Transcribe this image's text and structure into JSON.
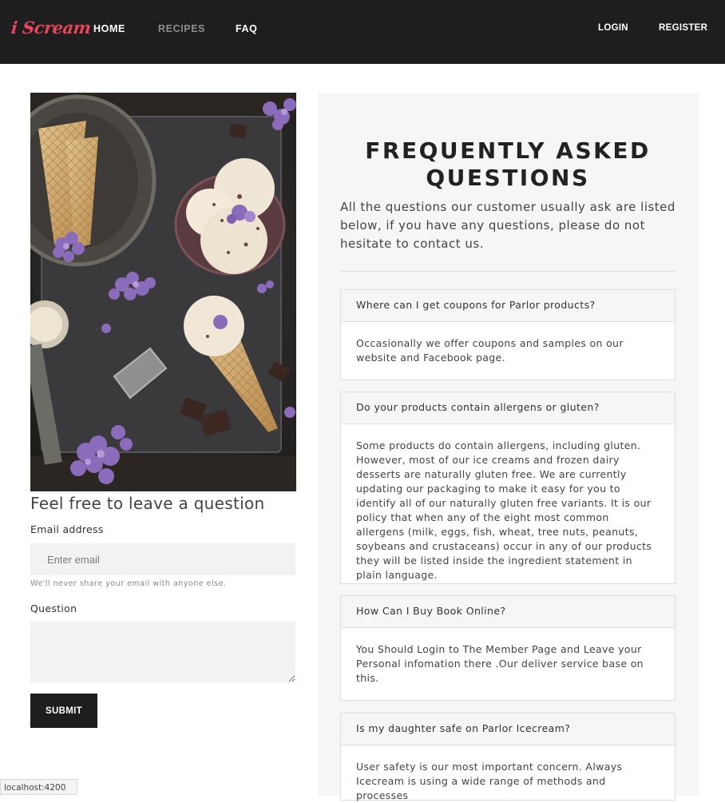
{
  "nav": {
    "logo": "i Scream",
    "links": [
      "HOME",
      "RECIPES",
      "FAQ"
    ],
    "login": "LOGIN",
    "register": "REGISTER"
  },
  "form": {
    "title": "Feel free to leave a question",
    "email_label": "Email address",
    "email_placeholder": "Enter email",
    "email_help": "We'll never share your email with anyone else.",
    "question_label": "Question",
    "submit": "SUBMIT"
  },
  "faq": {
    "title": "FREQUENTLY ASKED QUESTIONS",
    "intro": "All the questions our customer usually ask are listed below, if you have any questions, please do not hesitate to contact us.",
    "items": [
      {
        "question": "Where can I get coupons for Parlor products?",
        "answer": "Occasionally we offer coupons and samples on our website and Facebook page."
      },
      {
        "question": "Do your products contain allergens or gluten?",
        "answer": "Some products do contain allergens, including gluten. However, most of our ice creams and frozen dairy desserts are naturally gluten free. We are currently updating our packaging to make it easy for you to identify all of our naturally gluten free variants. It is our policy that when any of the eight most common allergens (milk, eggs, fish, wheat, tree nuts, peanuts, soybeans and crustaceans) occur in any of our products they will be listed inside the ingredient statement in plain language."
      },
      {
        "question": "How Can I Buy Book Online?",
        "answer": "You Should Login to The Member Page and Leave your Personal infomation there .Our deliver service base on this."
      },
      {
        "question": "Is my daughter safe on Parlor Icecream?",
        "answer": "User safety is our most important concern. Always Icecream is using a wide range of methods and processes"
      }
    ]
  },
  "status_bar": "localhost:4200"
}
